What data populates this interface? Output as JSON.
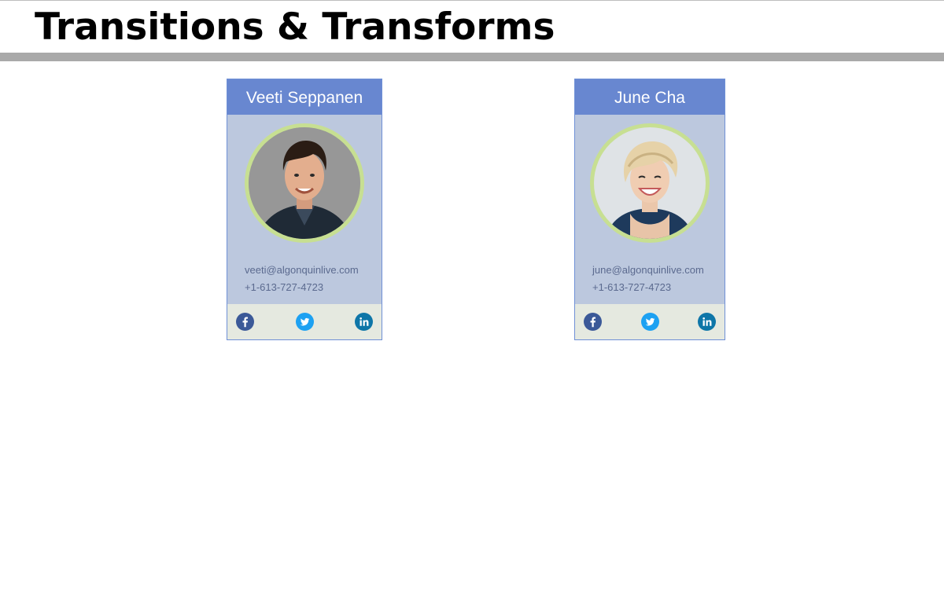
{
  "page": {
    "title": "Transitions & Transforms"
  },
  "cards": [
    {
      "name": "Veeti Seppanen",
      "email": "veeti@algonquinlive.com",
      "phone": "+1-613-727-4723",
      "avatar": "portrait-photo",
      "social": [
        "facebook-icon",
        "twitter-icon",
        "linkedin-icon"
      ]
    },
    {
      "name": "June Cha",
      "email": "june@algonquinlive.com",
      "phone": "+1-613-727-4723",
      "avatar": "portrait-photo",
      "social": [
        "facebook-icon",
        "twitter-icon",
        "linkedin-icon"
      ]
    }
  ],
  "colors": {
    "name_bar": "#6887d0",
    "card_body": "#bcc8de",
    "avatar_ring": "#c7df92",
    "social_bar": "#e5e9e0",
    "facebook": "#3b5998",
    "twitter": "#1da1f2",
    "linkedin": "#0e76a8",
    "header_rule": "#a9a9a9"
  }
}
